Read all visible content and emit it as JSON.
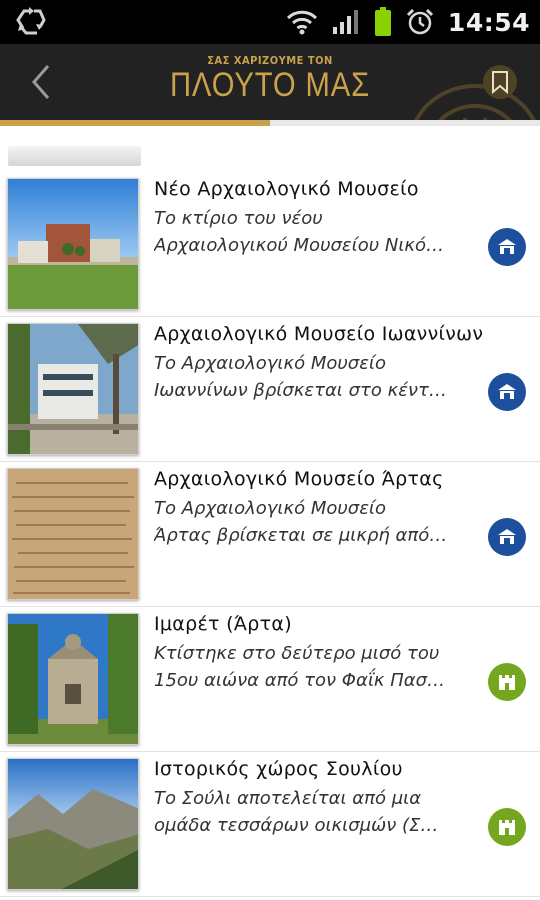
{
  "status_bar": {
    "time": "14:54",
    "icons": [
      "recycle-icon",
      "wifi-icon",
      "signal-icon",
      "battery-icon",
      "alarm-icon"
    ]
  },
  "app_bar": {
    "logo_small": "ΣΑΣ ΧΑΡΙΖΟΥΜΕ ΤΟΝ",
    "logo_big": "ΠΛΟΥΤΟ ΜΑΣ",
    "back_icon": "back-chevron-icon",
    "bookmark_icon": "bookmark-icon"
  },
  "colors": {
    "appbar": "#222222",
    "gold": "#c9a24a",
    "museum_badge": "#1c4f9c",
    "monument_badge": "#74a71d"
  },
  "loading": {
    "progress": 0.5
  },
  "items": [
    {
      "title": "Νέο Αρχαιολογικό Μουσείο",
      "desc_line1": "Το κτίριο του νέου",
      "desc_line2": "Αρχαιολογικού Μουσείου Νικό…",
      "category_icon": "museum-icon"
    },
    {
      "title": "Αρχαιολογικό Μουσείο Ιωαννίνων",
      "desc_line1": "Το Αρχαιολογικό Μουσείο",
      "desc_line2": "Ιωαννίνων βρίσκεται στο κέντ…",
      "category_icon": "museum-icon"
    },
    {
      "title": "Αρχαιολογικό Μουσείο Άρτας",
      "desc_line1": "Το Αρχαιολογικό Μουσείο",
      "desc_line2": "Άρτας βρίσκεται σε μικρή από…",
      "category_icon": "museum-icon"
    },
    {
      "title": "Ιμαρέτ (Άρτα)",
      "desc_line1": "Κτίστηκε στο δεύτερο μισό του",
      "desc_line2": "15ου αιώνα από τον Φαΐκ Πασ…",
      "category_icon": "castle-icon"
    },
    {
      "title": "Ιστορικός χώρος Σουλίου",
      "desc_line1": "Το Σούλι αποτελείται από μια",
      "desc_line2": "ομάδα τεσσάρων οικισμών (Σ…",
      "category_icon": "castle-icon"
    }
  ]
}
